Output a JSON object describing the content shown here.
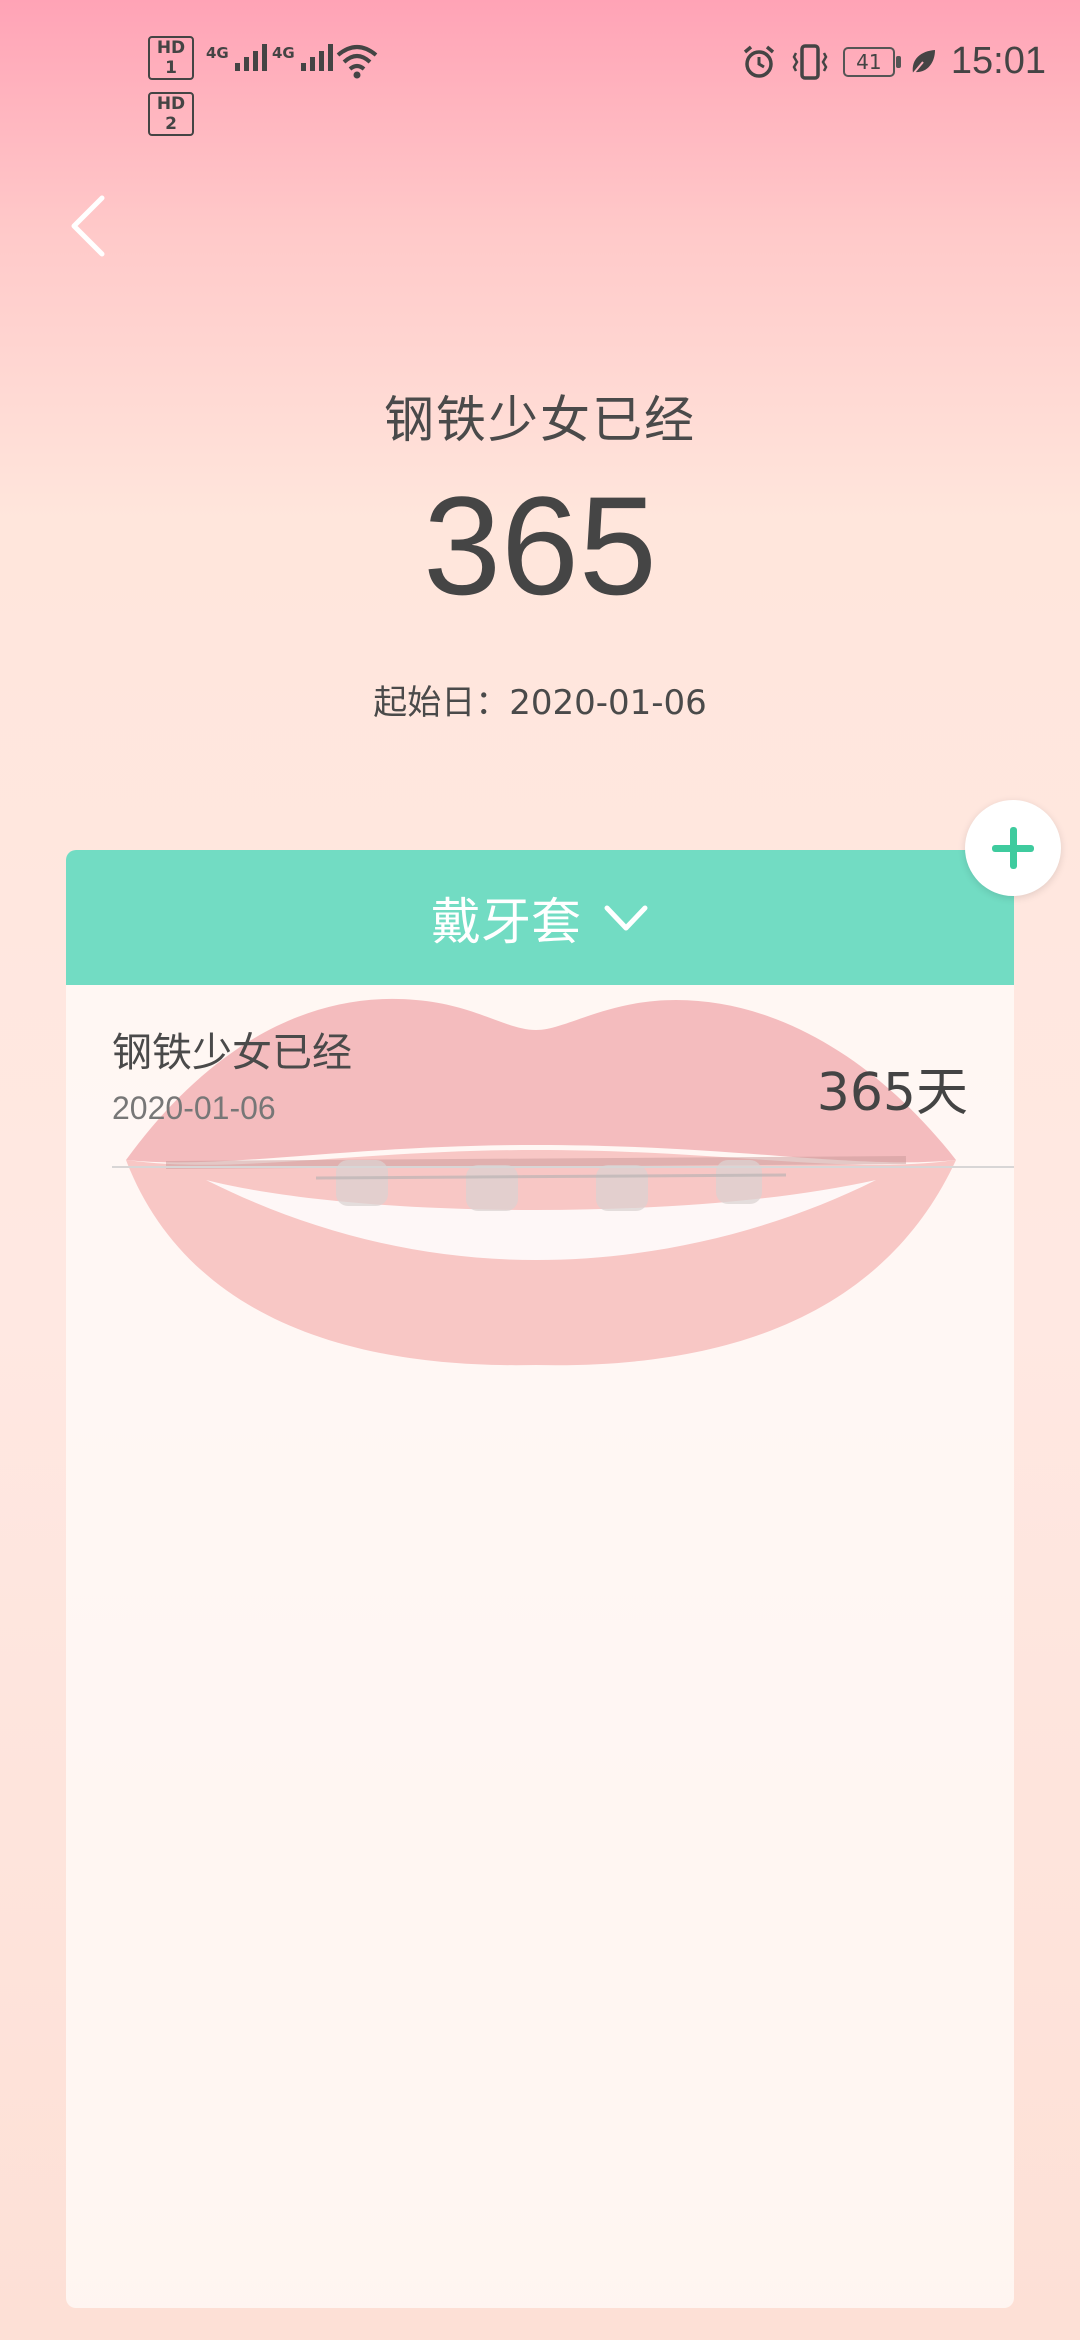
{
  "status_bar": {
    "sim1": "HD 1",
    "sim2": "HD 2",
    "network1": "4G",
    "network2": "4G",
    "battery": "41",
    "time": "15:01"
  },
  "header": {
    "title": "钢铁少女已经",
    "count": "365",
    "start_label": "起始日：2020-01-06"
  },
  "card": {
    "category": "戴牙套",
    "items": [
      {
        "name": "钢铁少女已经",
        "date": "2020-01-06",
        "days": "365天"
      }
    ]
  },
  "colors": {
    "accent": "#72dcc3",
    "add_icon": "#3fcb9e"
  }
}
